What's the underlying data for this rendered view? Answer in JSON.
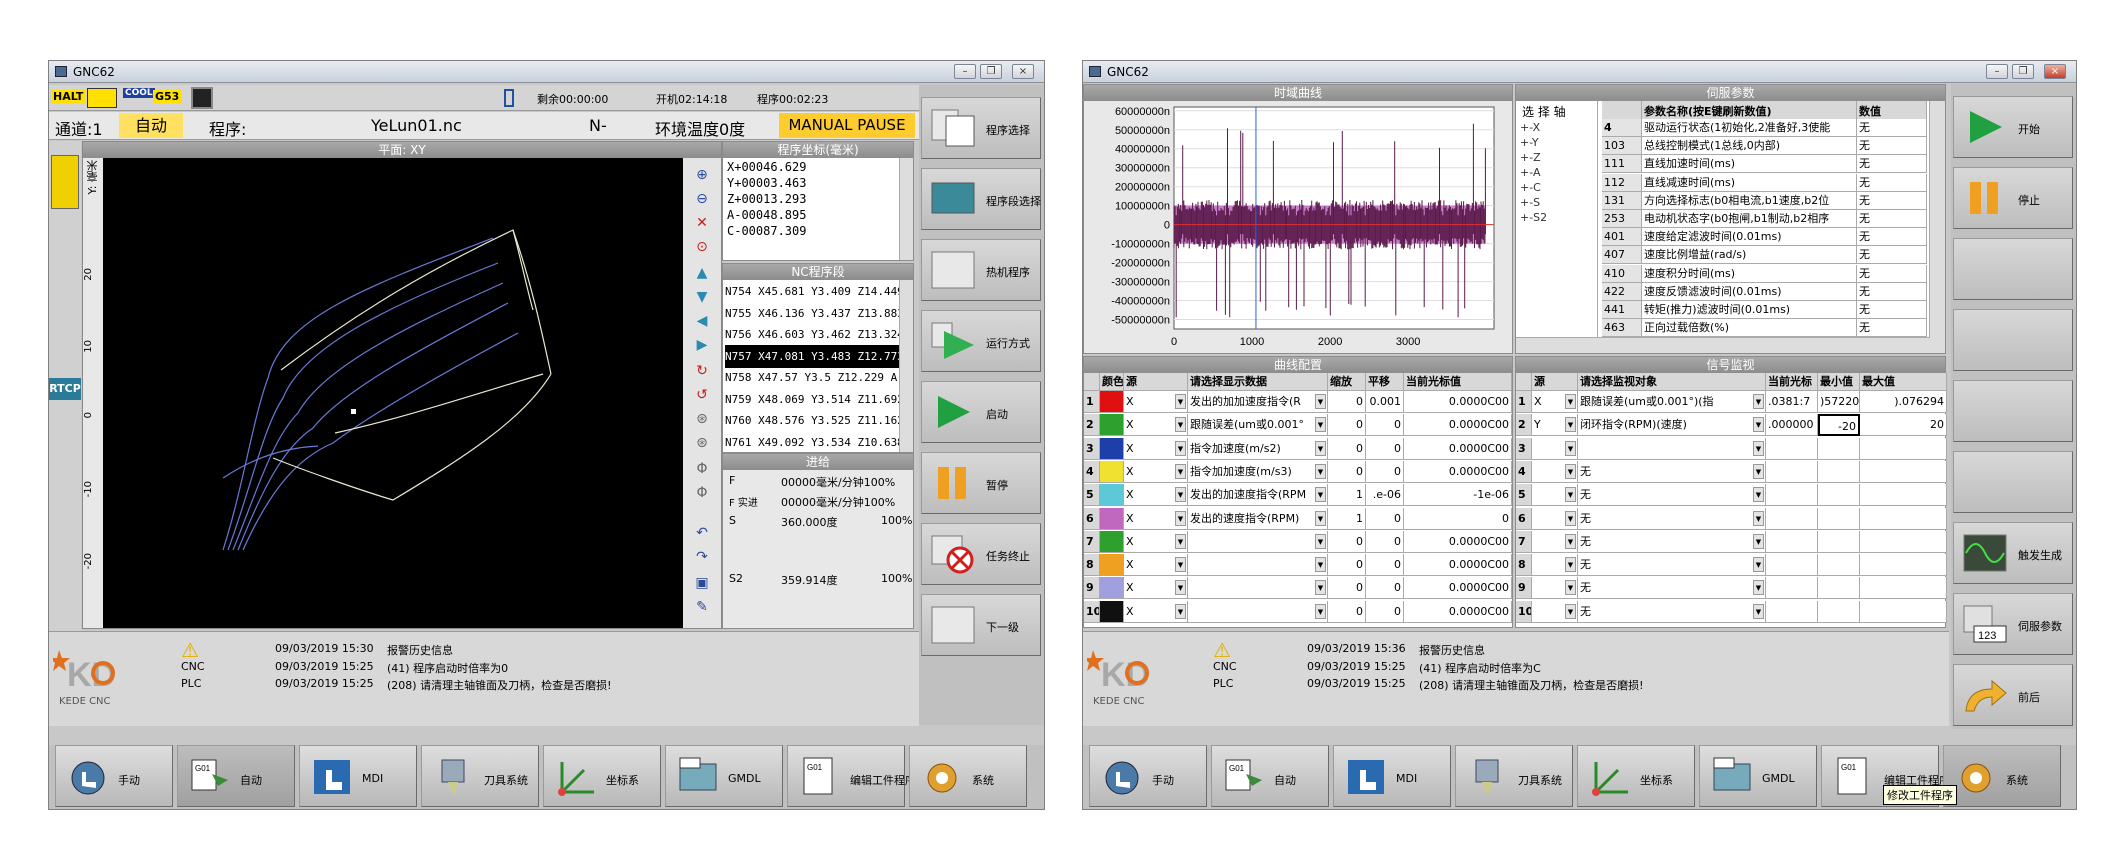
{
  "left": {
    "title": "GNC62",
    "status": {
      "halt": "HALT",
      "cool": "COOL",
      "g53": "G53",
      "remaining": "剩余00:00:00",
      "power_on": "开机02:14:18",
      "program_time": "程序00:02:23"
    },
    "info": {
      "channel": "通道:1",
      "mode": "自动",
      "program_label": "程序:",
      "program_name": "YeLun01.nc",
      "n": "N-",
      "env": "环境温度0度",
      "pause": "MANUAL PAUSE"
    },
    "plot": {
      "title": "平面: XY",
      "ylabel": "Y: 毫米",
      "y_ticks": [
        "20",
        "10",
        "0",
        "-10",
        "-20"
      ],
      "rtcp": "RTCP"
    },
    "coords": {
      "title": "程序坐标(毫米)",
      "lines": [
        "X+00046.629",
        "Y+00003.463",
        "Z+00013.293",
        "A-00048.895",
        "C-00087.309"
      ]
    },
    "nc": {
      "title": "NC程序段",
      "lines": [
        "N754 X45.681 Y3.409 Z14.449",
        "N755 X46.136 Y3.437 Z13.883",
        "N756 X46.603 Y3.462 Z13.324",
        "N757 X47.081 Y3.483 Z12.773",
        "N758 X47.57 Y3.5 Z12.229 A-",
        "N759 X48.069 Y3.514 Z11.692",
        "N760 X48.576 Y3.525 Z11.162",
        "N761 X49.092 Y3.534 Z10.638"
      ],
      "selected": 3
    },
    "feed": {
      "title": "进给",
      "rows": [
        {
          "k": "F",
          "v": "00000毫米/分钟100%"
        },
        {
          "k": "F 实进",
          "v": "00000毫米/分钟100%"
        },
        {
          "k": "S",
          "v": "360.000度",
          "p": "100%"
        },
        {
          "k": "S2",
          "v": "359.914度",
          "p": "100%"
        }
      ]
    },
    "alarm": {
      "head_date": "09/03/2019 15:30",
      "head_text": "报警历史信息",
      "r1_src": "CNC",
      "r1_date": "09/03/2019 15:25",
      "r1_text": "(41) 程序启动时倍率为0",
      "r2_src": "PLC",
      "r2_date": "09/03/2019 15:25",
      "r2_text": "(208) 请清理主轴锥面及刀柄，检查是否磨损!"
    },
    "logo_text": "KEDE CNC",
    "side_buttons": [
      "程序选择",
      "程序段选择",
      "热机程序",
      "运行方式",
      "启动",
      "暂停",
      "任务终止",
      "下一级"
    ],
    "bottom_buttons": [
      "手动",
      "自动",
      "MDI",
      "刀具系统",
      "坐标系",
      "GMDL",
      "编辑工件程序",
      "系统"
    ]
  },
  "right": {
    "title": "GNC62",
    "chart_title": "时域曲线",
    "servo_title": "伺服参数",
    "curve_cfg_title": "曲线配置",
    "signal_title": "信号监视",
    "axis_select": "选 择 轴",
    "axes": [
      "X",
      "Y",
      "Z",
      "A",
      "C",
      "S",
      "S2"
    ],
    "param_headers": [
      "参数名称(按E键刷新数值)",
      "数值"
    ],
    "params": [
      {
        "id": "4",
        "name": "驱动运行状态(1初始化,2准备好,3使能",
        "val": "无"
      },
      {
        "id": "103",
        "name": "总线控制模式(1总线,0内部)",
        "val": "无"
      },
      {
        "id": "111",
        "name": "直线加速时间(ms)",
        "val": "无"
      },
      {
        "id": "112",
        "name": "直线减速时间(ms)",
        "val": "无"
      },
      {
        "id": "131",
        "name": "方向选择标志(b0相电流,b1速度,b2位",
        "val": "无"
      },
      {
        "id": "253",
        "name": "电动机状态字(b0抱闸,b1制动,b2相序",
        "val": "无"
      },
      {
        "id": "401",
        "name": "速度给定滤波时间(0.01ms)",
        "val": "无"
      },
      {
        "id": "407",
        "name": "速度比例增益(rad/s)",
        "val": "无"
      },
      {
        "id": "410",
        "name": "速度积分时间(ms)",
        "val": "无"
      },
      {
        "id": "422",
        "name": "速度反馈滤波时间(0.01ms)",
        "val": "无"
      },
      {
        "id": "441",
        "name": "转矩(推力)滤波时间(0.01ms)",
        "val": "无"
      },
      {
        "id": "463",
        "name": "正向过载倍数(%)",
        "val": "无"
      }
    ],
    "cfg_headers": [
      "颜色",
      "源",
      "请选择显示数据",
      "缩放",
      "平移",
      "当前光标值"
    ],
    "cfg_rows": [
      {
        "n": "1",
        "color": "#e01010",
        "src": "X",
        "data": "发出的加加速度指令(R",
        "scale": "0",
        "shift": "0.001",
        "cur": "0.0000C00"
      },
      {
        "n": "2",
        "color": "#2ea02e",
        "src": "X",
        "data": "跟随误差(um或0.001°",
        "scale": "0",
        "shift": "0",
        "cur": "0.0000C00"
      },
      {
        "n": "3",
        "color": "#1e3fa8",
        "src": "X",
        "data": "指令加速度(m/s2)",
        "scale": "0",
        "shift": "0",
        "cur": "0.0000C00"
      },
      {
        "n": "4",
        "color": "#f0e030",
        "src": "X",
        "data": "指令加加速度(m/s3)",
        "scale": "0",
        "shift": "0",
        "cur": "0.0000C00"
      },
      {
        "n": "5",
        "color": "#5cc8d8",
        "src": "X",
        "data": "发出的加速度指令(RPM",
        "scale": "1",
        "shift": ".e-06",
        "cur": "-1e-06"
      },
      {
        "n": "6",
        "color": "#c068c0",
        "src": "X",
        "data": "发出的速度指令(RPM)",
        "scale": "1",
        "shift": "0",
        "cur": "0"
      },
      {
        "n": "7",
        "color": "#2ea02e",
        "src": "X",
        "data": "",
        "scale": "0",
        "shift": "0",
        "cur": "0.0000C00"
      },
      {
        "n": "8",
        "color": "#f0a020",
        "src": "X",
        "data": "",
        "scale": "0",
        "shift": "0",
        "cur": "0.0000C00"
      },
      {
        "n": "9",
        "color": "#a0a0e0",
        "src": "X",
        "data": "",
        "scale": "0",
        "shift": "0",
        "cur": "0.0000C00"
      },
      {
        "n": "10",
        "color": "#101010",
        "src": "X",
        "data": "",
        "scale": "0",
        "shift": "0",
        "cur": "0.0000C00"
      }
    ],
    "sig_headers": [
      "源",
      "请选择监视对象",
      "当前光标",
      "最小值",
      "最大值"
    ],
    "sig_rows": [
      {
        "n": "1",
        "src": "X",
        "obj": "跟随误差(um或0.001°)(指",
        "cur": ".0381:7",
        "min": ")57220",
        "max": ").076294"
      },
      {
        "n": "2",
        "src": "Y",
        "obj": "闭环指令(RPM)(速度)",
        "cur": ".000000",
        "min": "-20",
        "max": "20"
      },
      {
        "n": "3",
        "src": "",
        "obj": "",
        "cur": "",
        "min": "",
        "max": ""
      },
      {
        "n": "4",
        "src": "",
        "obj": "无",
        "cur": "",
        "min": "",
        "max": ""
      },
      {
        "n": "5",
        "src": "",
        "obj": "无",
        "cur": "",
        "min": "",
        "max": ""
      },
      {
        "n": "6",
        "src": "",
        "obj": "无",
        "cur": "",
        "min": "",
        "max": ""
      },
      {
        "n": "7",
        "src": "",
        "obj": "无",
        "cur": "",
        "min": "",
        "max": ""
      },
      {
        "n": "8",
        "src": "",
        "obj": "无",
        "cur": "",
        "min": "",
        "max": ""
      },
      {
        "n": "9",
        "src": "",
        "obj": "无",
        "cur": "",
        "min": "",
        "max": ""
      },
      {
        "n": "10",
        "src": "",
        "obj": "无",
        "cur": "",
        "min": "",
        "max": ""
      }
    ],
    "alarm": {
      "head_date": "09/03/2019 15:36",
      "head_text": "报警历史信息",
      "r1_src": "CNC",
      "r1_date": "09/03/2019 15:25",
      "r1_text": "(41) 程序启动时倍率为C",
      "r2_src": "PLC",
      "r2_date": "09/03/2019 15:25",
      "r2_text": "(208) 请清理主轴锥面及刀柄，检查是否磨损!"
    },
    "logo_text": "KEDE CNC",
    "side_buttons": [
      "开始",
      "停止",
      "",
      "",
      "",
      "",
      "触发生成",
      "伺服参数",
      "前后"
    ],
    "bottom_buttons": [
      "手动",
      "自动",
      "MDI",
      "刀具系统",
      "坐标系",
      "GMDL",
      "编辑工件程序",
      "系统"
    ],
    "tooltip": "修改工件程序"
  },
  "chart_data": {
    "type": "line",
    "title": "时域曲线",
    "x_ticks": [
      "0",
      "1000",
      "2000",
      "3000"
    ],
    "y_ticks": [
      "60000000n",
      "50000000n",
      "40000000n",
      "30000000n",
      "20000000n",
      "10000000n",
      "0",
      "-10000000n",
      "-20000000n",
      "-30000000n",
      "-40000000n",
      "-50000000n"
    ],
    "xlim": [
      0,
      4100
    ],
    "ylim": [
      -55000000,
      62000000
    ],
    "series": [
      {
        "color": "#c068c0",
        "band": [
          -10000000,
          10000000
        ]
      },
      {
        "color": "#5a1a4a",
        "spikes": true
      }
    ]
  }
}
